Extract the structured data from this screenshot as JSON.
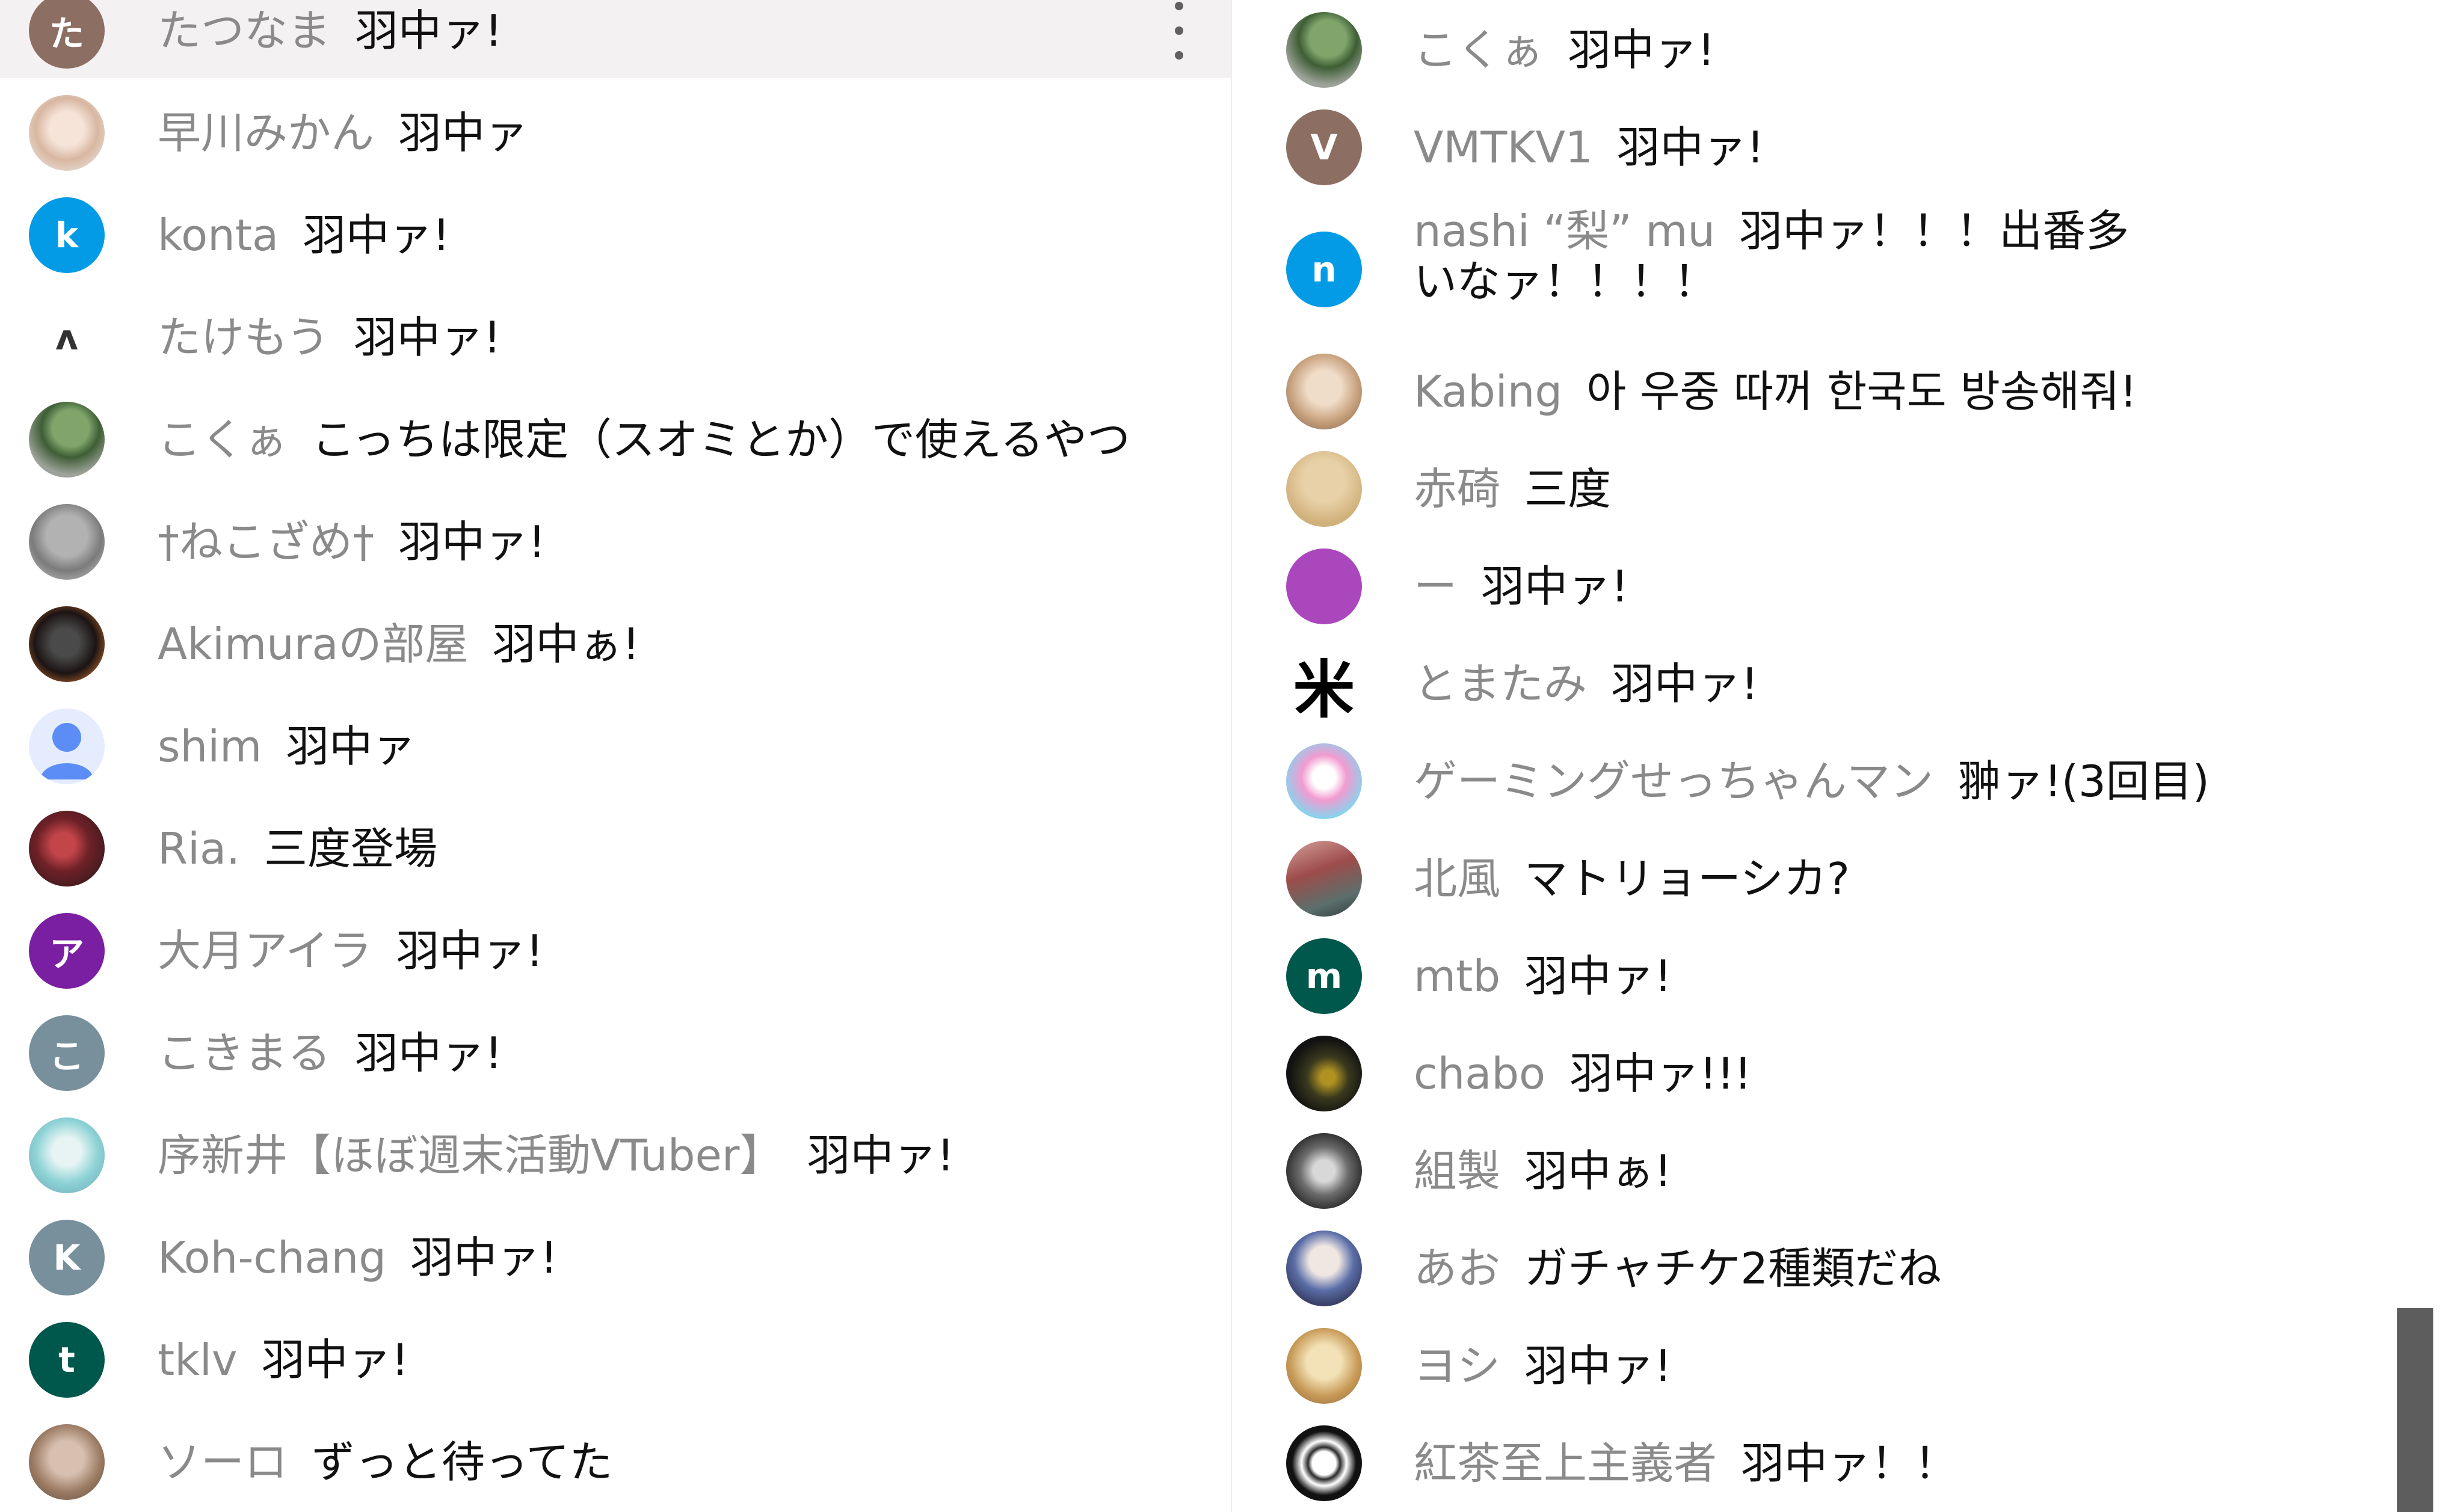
{
  "left_chat": {
    "messages": [
      {
        "author": "たつなま",
        "text": "羽中ァ!",
        "avatar": {
          "kind": "letter",
          "letter": "た",
          "color": "#8d6e63"
        },
        "highlighted": true,
        "menu_icon": "more-vert-icon"
      },
      {
        "author": "早川みかん",
        "text": "羽中ァ",
        "avatar": {
          "kind": "photo",
          "style": "photo-girl"
        }
      },
      {
        "author": "konta",
        "text": "羽中ァ!",
        "avatar": {
          "kind": "letter",
          "letter": "k",
          "color": "#039be5"
        }
      },
      {
        "author": "たけもう",
        "text": "羽中ァ!",
        "avatar": {
          "kind": "glyph",
          "glyph": "ᴧ"
        }
      },
      {
        "author": "こくぁ",
        "text": "こっちは限定（スオミとか）で使えるやつ",
        "avatar": {
          "kind": "photo",
          "style": "photo-green"
        }
      },
      {
        "author": "†ねこざめ†",
        "text": "羽中ァ!",
        "avatar": {
          "kind": "photo",
          "style": "photo-gray"
        }
      },
      {
        "author": "Akimuraの部屋",
        "text": "羽中ぁ!",
        "avatar": {
          "kind": "photo",
          "style": "photo-dark"
        }
      },
      {
        "author": "shim",
        "text": "羽中ァ",
        "avatar": {
          "kind": "person",
          "color": "#5c8df6"
        }
      },
      {
        "author": "Ria.",
        "text": "三度登場",
        "avatar": {
          "kind": "photo",
          "style": "photo-red"
        }
      },
      {
        "author": "大月アイラ",
        "text": "羽中ァ!",
        "avatar": {
          "kind": "letter",
          "letter": "ア",
          "color": "#7b1fa2"
        }
      },
      {
        "author": "こきまる",
        "text": "羽中ァ!",
        "avatar": {
          "kind": "letter",
          "letter": "こ",
          "color": "#78909c"
        }
      },
      {
        "author": "序新井【ほぼ週末活動VTuber】",
        "text": "羽中ァ!",
        "avatar": {
          "kind": "photo",
          "style": "photo-teal"
        }
      },
      {
        "author": "Koh-chang",
        "text": "羽中ァ!",
        "avatar": {
          "kind": "letter",
          "letter": "K",
          "color": "#78909c"
        }
      },
      {
        "author": "tklv",
        "text": "羽中ァ!",
        "avatar": {
          "kind": "letter",
          "letter": "t",
          "color": "#00574b"
        }
      },
      {
        "author": "ソーロ",
        "text": "ずっと待ってた",
        "avatar": {
          "kind": "photo",
          "style": "photo-cat"
        }
      }
    ]
  },
  "right_chat": {
    "messages": [
      {
        "author": "こくぁ",
        "text": "羽中ァ!",
        "avatar": {
          "kind": "photo",
          "style": "photo-green"
        }
      },
      {
        "author": "VMTKV1",
        "text": "羽中ァ!",
        "avatar": {
          "kind": "letter",
          "letter": "V",
          "color": "#8d6e63"
        }
      },
      {
        "author": "nashi “梨” mu",
        "text": "羽中ァ！！！出番多いなァ！！！！",
        "avatar": {
          "kind": "letter",
          "letter": "n",
          "color": "#039be5"
        },
        "wrap": true
      },
      {
        "author": "Kabing",
        "text": "아 우중 따꺼 한국도 방송해줘!",
        "avatar": {
          "kind": "photo",
          "style": "photo-face"
        }
      },
      {
        "author": "赤碕",
        "text": "三度",
        "avatar": {
          "kind": "photo",
          "style": "photo-tan"
        }
      },
      {
        "author": "ー",
        "text": "羽中ァ!",
        "avatar": {
          "kind": "letter",
          "letter": "",
          "color": "#ab47bc"
        }
      },
      {
        "author": "とまたみ",
        "text": "羽中ァ!",
        "avatar": {
          "kind": "glyph-dark",
          "glyph": "米"
        }
      },
      {
        "author": "ゲーミングせっちゃんマン",
        "text": "翀ァ!(3回目)",
        "avatar": {
          "kind": "photo",
          "style": "photo-pink"
        }
      },
      {
        "author": "北風",
        "text": "マトリョーシカ?",
        "avatar": {
          "kind": "photo",
          "style": "photo-street"
        }
      },
      {
        "author": "mtb",
        "text": "羽中ァ!",
        "avatar": {
          "kind": "letter",
          "letter": "m",
          "color": "#00574b"
        }
      },
      {
        "author": "chabo",
        "text": "羽中ァ!!!",
        "avatar": {
          "kind": "photo",
          "style": "photo-night"
        }
      },
      {
        "author": "組製",
        "text": "羽中ぁ!",
        "avatar": {
          "kind": "photo",
          "style": "photo-gear"
        }
      },
      {
        "author": "あお",
        "text": "ガチャチケ2種類だね",
        "avatar": {
          "kind": "photo",
          "style": "photo-anime"
        }
      },
      {
        "author": "ヨシ",
        "text": "羽中ァ!",
        "avatar": {
          "kind": "photo",
          "style": "photo-bread"
        }
      },
      {
        "author": "紅茶至上主義者",
        "text": "羽中ァ！！",
        "avatar": {
          "kind": "photo",
          "style": "photo-globe"
        }
      }
    ]
  },
  "colors": {
    "author_text": "#8a8a8a",
    "message_text": "#111111",
    "highlight_row": "#f4f1f3",
    "scrollbar": "#6d6d6d"
  }
}
